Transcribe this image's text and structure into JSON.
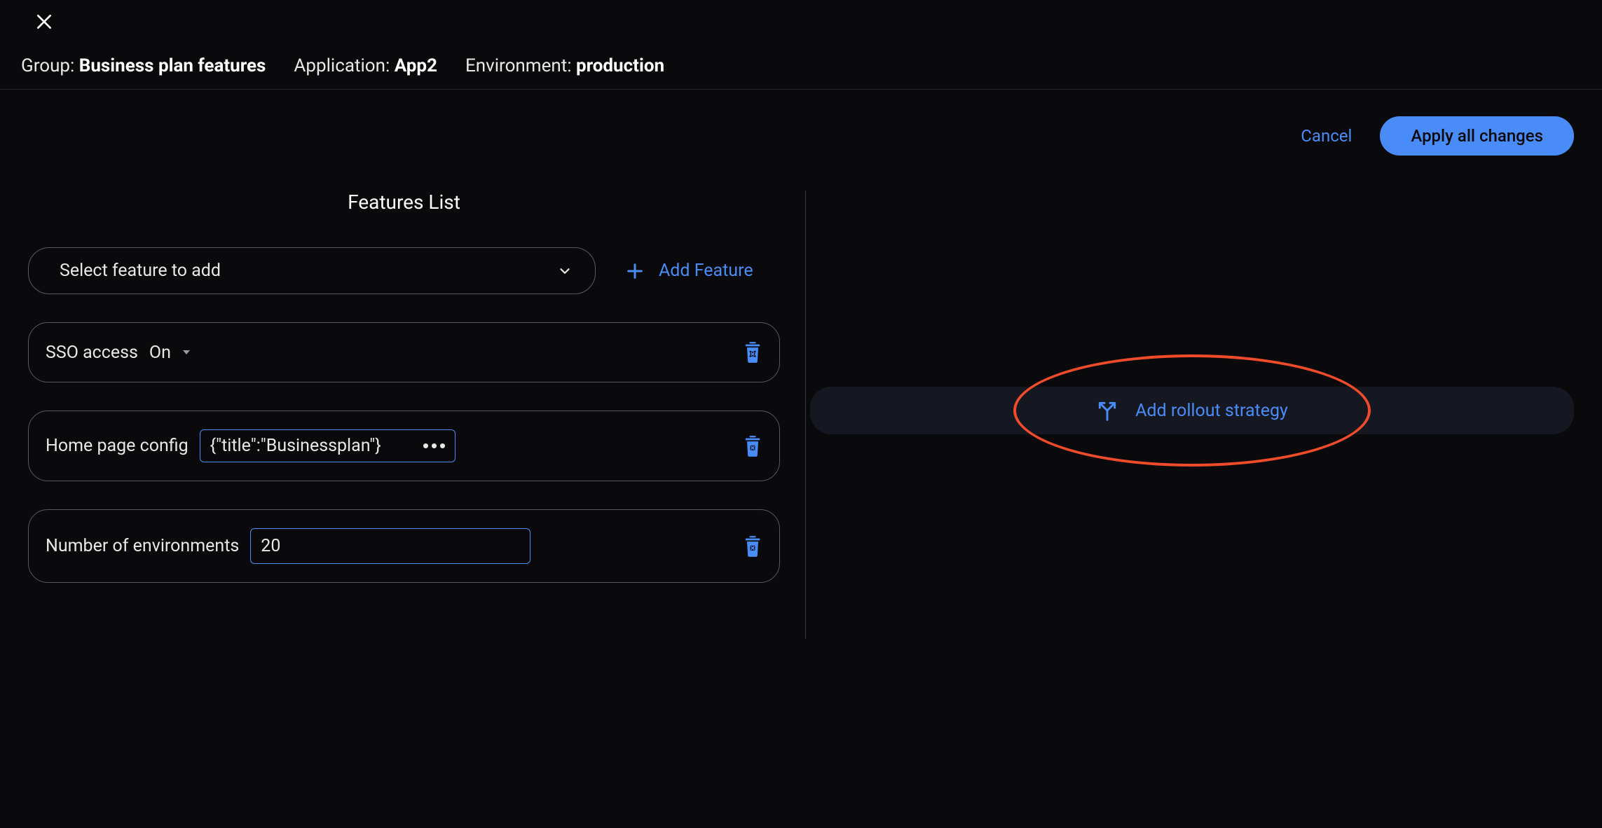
{
  "breadcrumb": {
    "group_label": "Group:",
    "group_value": "Business plan features",
    "application_label": "Application:",
    "application_value": "App2",
    "environment_label": "Environment:",
    "environment_value": "production"
  },
  "actions": {
    "cancel_label": "Cancel",
    "apply_label": "Apply all changes"
  },
  "left": {
    "section_title": "Features List",
    "dropdown_placeholder": "Select feature to add",
    "add_feature_label": "Add Feature",
    "features": [
      {
        "name": "SSO access",
        "state_label": "On"
      },
      {
        "name": "Home page config",
        "value_display": "{\"title\":\"Businessplan\"}"
      },
      {
        "name": "Number of environments",
        "value": "20"
      }
    ]
  },
  "right": {
    "add_rollout_label": "Add rollout strategy"
  },
  "colors": {
    "accent": "#4a8cf7",
    "annotation": "#f04b2a"
  }
}
